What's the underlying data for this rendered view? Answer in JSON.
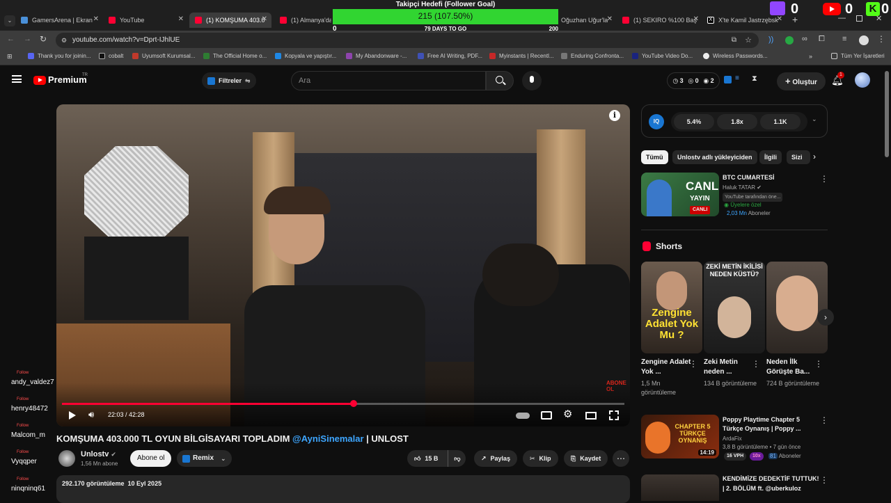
{
  "tabs": [
    {
      "title": "GamersArena | Ekran",
      "color": "#4a90d9"
    },
    {
      "title": "YouTube",
      "color": "#ff0033"
    },
    {
      "title": "(1) KOMŞUMA 403.0",
      "color": "#ff0033"
    },
    {
      "title": "(1) Almanya'da Y",
      "color": "#ff0033"
    },
    {
      "title": "Oğuzhan Uğur'la",
      "color": "#ff0033"
    },
    {
      "title": "(1) SEKIRO %100 Baş",
      "color": "#ff0033"
    },
    {
      "title": "X'te Kamil Jastrzębsk",
      "color": "#ffffff"
    }
  ],
  "omnibox_url": "youtube.com/watch?v=Dprt-IJhlUE",
  "bookmarks": [
    "Thank you for joinin...",
    "cobalt",
    "Uyumsoft Kurumsal...",
    "The Official Home o...",
    "Kopyala ve yapıştır...",
    "My Abandonware -...",
    "Free AI Writing, PDF...",
    "Myinstants | Recentl...",
    "Enduring Confronta...",
    "YouTube Video Do...",
    "Wireless Passwords...",
    "Tüm Yer İşaretleri"
  ],
  "goal": {
    "title": "Takipçi Hedefi (Follower Goal)",
    "value_text": "215 (107.50%)",
    "min": "0",
    "days": "79 DAYS TO GO",
    "max": "200",
    "progress": 1.0
  },
  "stream_stats": {
    "twitch": "0",
    "youtube": "0",
    "kick": "0"
  },
  "youtube": {
    "logo": "Premium",
    "logo_tr": "TR",
    "filters": "Filtreler",
    "search_placeholder": "Ara",
    "counters": [
      "3",
      "0",
      "2"
    ],
    "create": "Oluştur",
    "notif_count": "1"
  },
  "player": {
    "time": "22:03 / 42:28",
    "progress": 0.519,
    "overlay_corner": "ABONE OL"
  },
  "video": {
    "title_prefix": "KOMŞUMA 403.000 TL OYUN BİLGİSAYARI TOPLADIM ",
    "title_mention": "@AyniSinemalar",
    "title_suffix": " | UNLOST",
    "channel": "Unlostv",
    "subs": "1,56 Mn abone",
    "subscribe": "Abone ol",
    "remix": "Remix",
    "likes": "15 B",
    "share": "Paylaş",
    "clip": "Klip",
    "save": "Kaydet",
    "views_date": "292.170 görüntüleme  10 Eyl 2025"
  },
  "iq_stats": [
    "5.4%",
    "1.8x",
    "1.1K"
  ],
  "chips": [
    "Tümü",
    "Unlostv adlı yükleyiciden",
    "İlgili",
    "Sizi"
  ],
  "rec1": {
    "title": "BTC CUMARTESİ",
    "channel": "Haluk TATAR",
    "note": "YouTube tarafından öne...",
    "members": "Üyelere özel",
    "subs_val": "2,03 Mn",
    "subs_lbl": "Aboneler",
    "thumb_big": "CANLI",
    "thumb_small": "YAYIN",
    "live": "CANLI"
  },
  "shorts_label": "Shorts",
  "shorts": [
    {
      "title": "Zengine Adalet Yok ...",
      "meta": "1,5 Mn görüntüleme",
      "thumb": "Zengine Adalet Yok Mu ?"
    },
    {
      "title": "Zeki Metin neden ...",
      "meta": "134 B görüntüleme",
      "thumb": "ZEKİ METİN İKİLİSİ NEDEN KÜSTÜ?"
    },
    {
      "title": "Neden İlk Görüşte Ba...",
      "meta": "724 B görüntüleme",
      "thumb": ""
    }
  ],
  "rec2": {
    "title": "Poppy Playtime Chapter 5 Türkçe Oynanış | Poppy ...",
    "channel": "ArdaFix",
    "meta": "3,8 B görüntüleme • 7 gün önce",
    "vph": "16 VPH",
    "mult": "10x",
    "subs_val": "81",
    "subs_lbl": "Aboneler",
    "duration": "14:19",
    "thumb_text": "CHAPTER 5 TÜRKÇE OYNANIŞ"
  },
  "rec3": {
    "title": "KENDİMİZE DEDEKTİF TUTTUK!",
    "line2": "| 2. BÖLÜM ft. @uberkuloz"
  },
  "follows": {
    "label": "Follow",
    "names": [
      "andy_valdez7",
      "henry48472",
      "Malcom_m",
      "Vyqqper",
      "ninqninq61"
    ]
  }
}
